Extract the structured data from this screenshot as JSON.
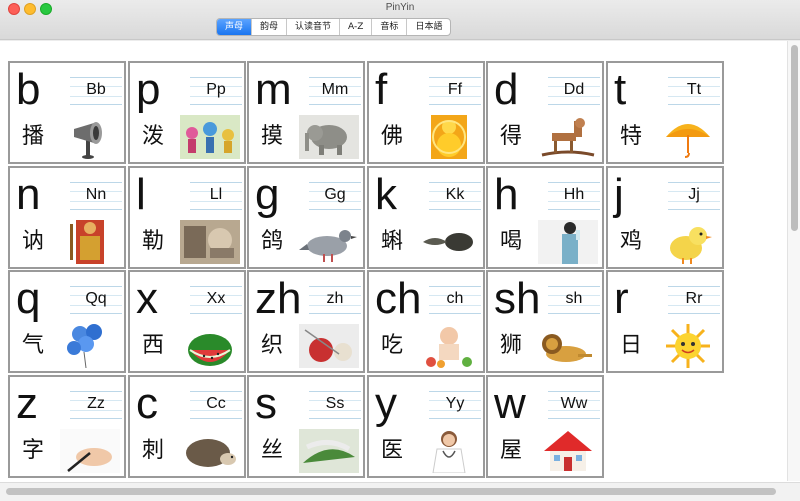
{
  "window": {
    "title": "PinYin"
  },
  "tabs": [
    {
      "label": "声母",
      "active": true
    },
    {
      "label": "韵母",
      "active": false
    },
    {
      "label": "认读音节",
      "active": false
    },
    {
      "label": "A-Z",
      "active": false
    },
    {
      "label": "音标",
      "active": false
    },
    {
      "label": "日本語",
      "active": false
    }
  ],
  "cells": [
    {
      "letter": "b",
      "pair": "Bb",
      "hanzi": "播",
      "picture": "megaphone-icon"
    },
    {
      "letter": "p",
      "pair": "Pp",
      "hanzi": "泼",
      "picture": "water-splash-photo"
    },
    {
      "letter": "m",
      "pair": "Mm",
      "hanzi": "摸",
      "picture": "elephant-photo"
    },
    {
      "letter": "f",
      "pair": "Ff",
      "hanzi": "佛",
      "picture": "buddha-statue-photo"
    },
    {
      "letter": "d",
      "pair": "Dd",
      "hanzi": "得",
      "picture": "rocking-horse-photo"
    },
    {
      "letter": "t",
      "pair": "Tt",
      "hanzi": "特",
      "picture": "umbrella-icon"
    },
    {
      "letter": "n",
      "pair": "Nn",
      "hanzi": "讷",
      "picture": "guardian-figure-photo"
    },
    {
      "letter": "l",
      "pair": "Ll",
      "hanzi": "勒",
      "picture": "horse-harness-photo"
    },
    {
      "letter": "g",
      "pair": "Gg",
      "hanzi": "鸽",
      "picture": "pigeon-photo"
    },
    {
      "letter": "k",
      "pair": "Kk",
      "hanzi": "蝌",
      "picture": "tadpole-photo"
    },
    {
      "letter": "h",
      "pair": "Hh",
      "hanzi": "喝",
      "picture": "woman-drinking-photo"
    },
    {
      "letter": "j",
      "pair": "Jj",
      "hanzi": "鸡",
      "picture": "chick-icon"
    },
    {
      "letter": "q",
      "pair": "Qq",
      "hanzi": "气",
      "picture": "balloons-icon"
    },
    {
      "letter": "x",
      "pair": "Xx",
      "hanzi": "西",
      "picture": "watermelon-icon"
    },
    {
      "letter": "zh",
      "pair": "zh",
      "hanzi": "织",
      "picture": "knitting-photo"
    },
    {
      "letter": "ch",
      "pair": "ch",
      "hanzi": "吃",
      "picture": "baby-eating-photo"
    },
    {
      "letter": "sh",
      "pair": "sh",
      "hanzi": "狮",
      "picture": "lion-photo"
    },
    {
      "letter": "r",
      "pair": "Rr",
      "hanzi": "日",
      "picture": "sun-icon"
    },
    {
      "letter": "z",
      "pair": "Zz",
      "hanzi": "字",
      "picture": "hand-writing-photo"
    },
    {
      "letter": "c",
      "pair": "Cc",
      "hanzi": "刺",
      "picture": "hedgehog-photo"
    },
    {
      "letter": "s",
      "pair": "Ss",
      "hanzi": "丝",
      "picture": "silkworm-photo"
    },
    {
      "letter": "y",
      "pair": "Yy",
      "hanzi": "医",
      "picture": "doctor-photo"
    },
    {
      "letter": "w",
      "pair": "Ww",
      "hanzi": "屋",
      "picture": "house-icon"
    }
  ],
  "colors": {
    "active_tab": "#1a75f0",
    "cell_border": "#9a9a9a"
  }
}
